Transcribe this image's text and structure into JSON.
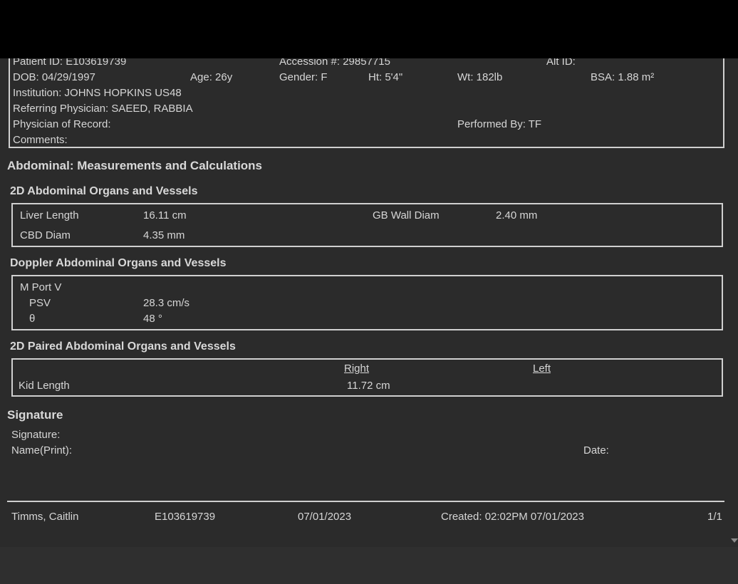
{
  "patient": {
    "patient_id": "Patient ID: E103619739",
    "accession": "Accession #: 29857715",
    "alt_id": "Alt ID:",
    "dob": "DOB: 04/29/1997",
    "age": "Age: 26y",
    "gender": "Gender: F",
    "height": "Ht: 5'4\"",
    "weight": "Wt: 182lb",
    "bsa": "BSA: 1.88 m²",
    "institution": "Institution: JOHNS HOPKINS US48",
    "referring": "Referring Physician: SAEED, RABBIA",
    "physician_record": "Physician of Record:",
    "performed_by": "Performed By: TF",
    "comments": "Comments:"
  },
  "report": {
    "title": "Abdominal: Measurements and Calculations",
    "sections": {
      "organs2d": {
        "title": "2D Abdominal Organs and Vessels",
        "rows": [
          {
            "label": "Liver Length",
            "value": "16.11 cm"
          },
          {
            "label": "GB Wall Diam",
            "value": "2.40 mm"
          },
          {
            "label": "CBD Diam",
            "value": "4.35 mm"
          }
        ]
      },
      "doppler": {
        "title": "Doppler Abdominal Organs and Vessels",
        "group": "M Port V",
        "rows": [
          {
            "label": "PSV",
            "value": "28.3 cm/s"
          },
          {
            "label": "θ",
            "value": "48 °"
          }
        ]
      },
      "paired": {
        "title": "2D Paired Abdominal Organs and Vessels",
        "col_right": "Right",
        "col_left": "Left",
        "rows": [
          {
            "label": "Kid Length",
            "right": "11.72 cm",
            "left": ""
          }
        ]
      }
    }
  },
  "signature": {
    "title": "Signature",
    "signature_label": "Signature:",
    "name_label": "Name(Print):",
    "date_label": "Date:"
  },
  "footer": {
    "name": "Timms, Caitlin",
    "id": "E103619739",
    "date": "07/01/2023",
    "created": "Created:  02:02PM 07/01/2023",
    "page": "1/1"
  }
}
